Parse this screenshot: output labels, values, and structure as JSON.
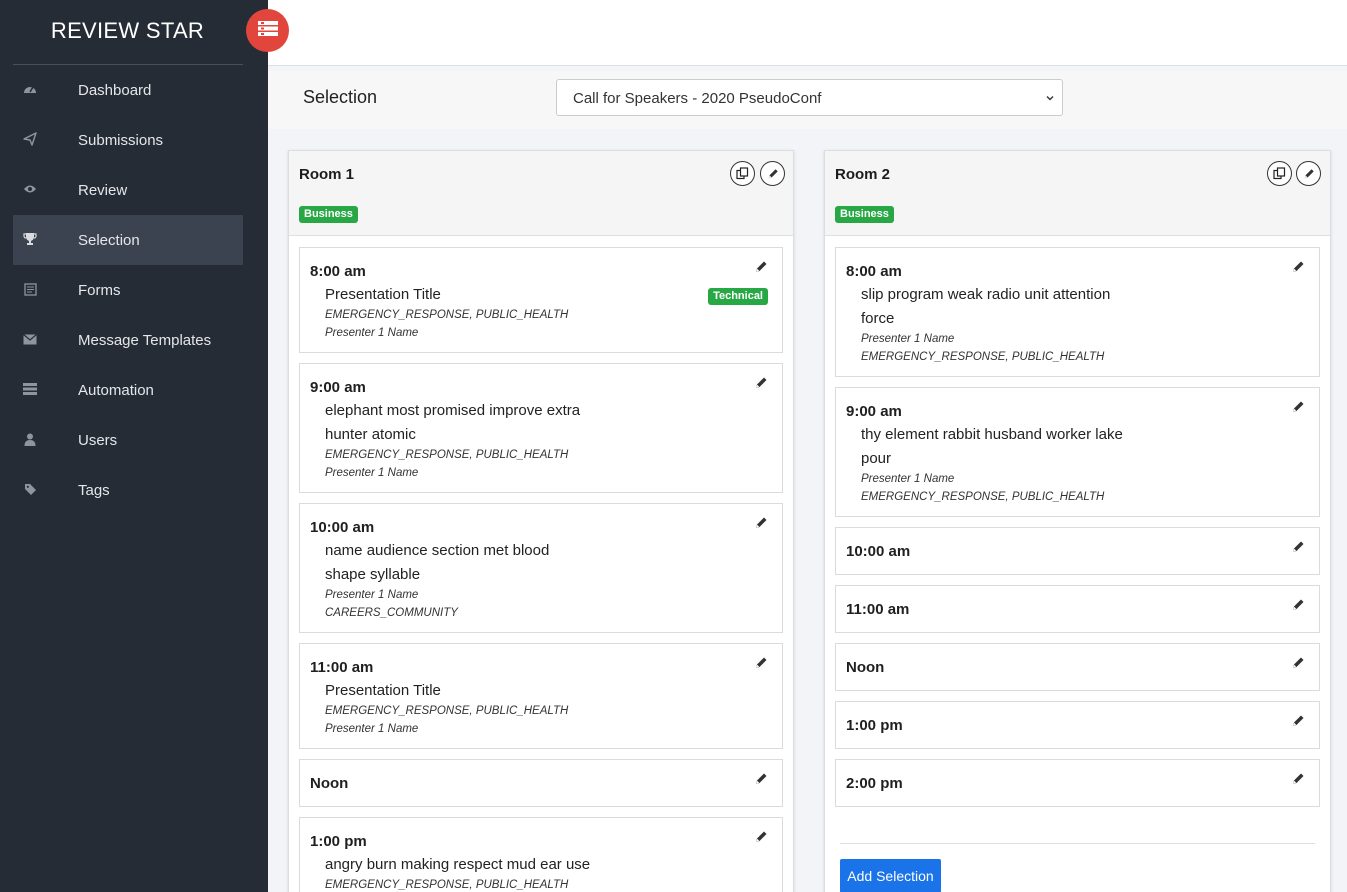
{
  "app": {
    "brand": "REVIEW STAR",
    "menu_icon": "menu-icon"
  },
  "sidebar": {
    "items": [
      {
        "label": "Dashboard",
        "icon": "dashboard-icon"
      },
      {
        "label": "Submissions",
        "icon": "paper-plane-icon"
      },
      {
        "label": "Review",
        "icon": "eye-icon"
      },
      {
        "label": "Selection",
        "icon": "trophy-icon",
        "active": true
      },
      {
        "label": "Forms",
        "icon": "form-icon"
      },
      {
        "label": "Message Templates",
        "icon": "envelope-icon"
      },
      {
        "label": "Automation",
        "icon": "list-icon"
      },
      {
        "label": "Users",
        "icon": "user-icon"
      },
      {
        "label": "Tags",
        "icon": "tag-icon"
      }
    ]
  },
  "selection": {
    "label": "Selection",
    "selected": "Call for Speakers - 2020 PseudoConf"
  },
  "rooms": [
    {
      "title": "Room 1",
      "tag": "Business",
      "slots": [
        {
          "time": "8:00 am",
          "title_lines": [
            "Presentation Title"
          ],
          "badge": "Technical",
          "meta": [
            "EMERGENCY_RESPONSE, PUBLIC_HEALTH",
            "Presenter 1 Name"
          ]
        },
        {
          "time": "9:00 am",
          "title_lines": [
            "elephant most promised improve extra",
            "hunter atomic"
          ],
          "meta": [
            "EMERGENCY_RESPONSE, PUBLIC_HEALTH",
            "Presenter 1 Name"
          ]
        },
        {
          "time": "10:00 am",
          "title_lines": [
            "name audience section met blood",
            "shape syllable"
          ],
          "meta": [
            "Presenter 1 Name",
            "CAREERS_COMMUNITY"
          ]
        },
        {
          "time": "11:00 am",
          "title_lines": [
            "Presentation Title"
          ],
          "meta": [
            "EMERGENCY_RESPONSE, PUBLIC_HEALTH",
            "Presenter 1 Name"
          ]
        },
        {
          "time": "Noon",
          "title_lines": [],
          "meta": []
        },
        {
          "time": "1:00 pm",
          "title_lines": [
            "angry burn making respect mud ear use"
          ],
          "meta": [
            "EMERGENCY_RESPONSE, PUBLIC_HEALTH"
          ]
        }
      ]
    },
    {
      "title": "Room 2",
      "tag": "Business",
      "slots": [
        {
          "time": "8:00 am",
          "title_lines": [
            "slip program weak radio unit attention",
            "force"
          ],
          "meta": [
            "Presenter 1 Name",
            "EMERGENCY_RESPONSE, PUBLIC_HEALTH"
          ]
        },
        {
          "time": "9:00 am",
          "title_lines": [
            "thy element rabbit husband worker lake",
            "pour"
          ],
          "meta": [
            "Presenter 1 Name",
            "EMERGENCY_RESPONSE, PUBLIC_HEALTH"
          ]
        },
        {
          "time": "10:00 am",
          "title_lines": [],
          "meta": []
        },
        {
          "time": "11:00 am",
          "title_lines": [],
          "meta": []
        },
        {
          "time": "Noon",
          "title_lines": [],
          "meta": []
        },
        {
          "time": "1:00 pm",
          "title_lines": [],
          "meta": []
        },
        {
          "time": "2:00 pm",
          "title_lines": [],
          "meta": []
        }
      ],
      "add_button": "Add Selection"
    }
  ],
  "colors": {
    "sidebar": "#262c36",
    "accent": "#e2453b",
    "badge": "#28a745",
    "primary": "#1a73e8"
  }
}
